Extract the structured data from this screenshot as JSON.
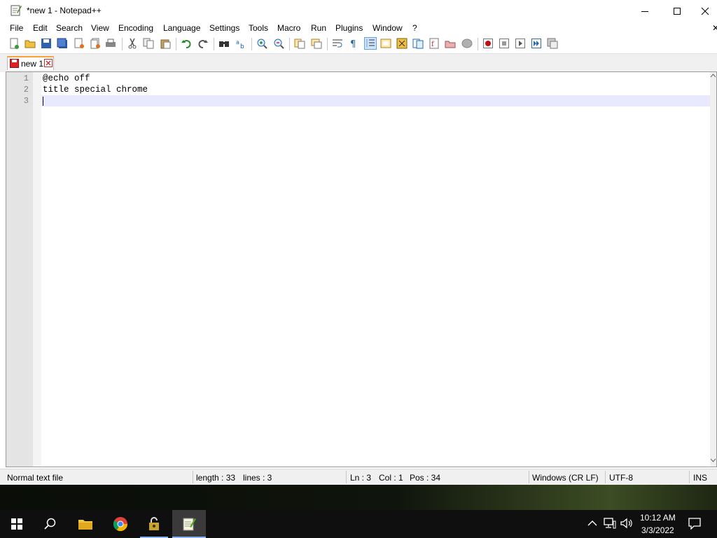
{
  "window": {
    "title": "*new 1 - Notepad++"
  },
  "menu": [
    "File",
    "Edit",
    "Search",
    "View",
    "Encoding",
    "Language",
    "Settings",
    "Tools",
    "Macro",
    "Run",
    "Plugins",
    "Window",
    "?"
  ],
  "tabs": [
    {
      "label": "new 1",
      "modified": true
    }
  ],
  "editor": {
    "line_numbers": [
      "1",
      "2",
      "3"
    ],
    "lines": [
      "@echo off",
      "title special chrome",
      ""
    ],
    "current_line": 3
  },
  "status": {
    "file_type": "Normal text file",
    "length": "length : 33",
    "lines": "lines : 3",
    "ln": "Ln : 3",
    "col": "Col : 1",
    "pos": "Pos : 34",
    "eol": "Windows (CR LF)",
    "encoding": "UTF-8",
    "mode": "INS"
  },
  "taskbar": {
    "apps": [
      "start-icon",
      "search-icon",
      "file-explorer-icon",
      "chrome-icon",
      "lock-app-icon",
      "notepadpp-icon"
    ],
    "time": "10:12 AM",
    "date": "3/3/2022"
  },
  "colors": {
    "tab_accent": "#f9a23b",
    "current_line": "#e8e8ff",
    "taskbar": "#0f0f0f"
  }
}
